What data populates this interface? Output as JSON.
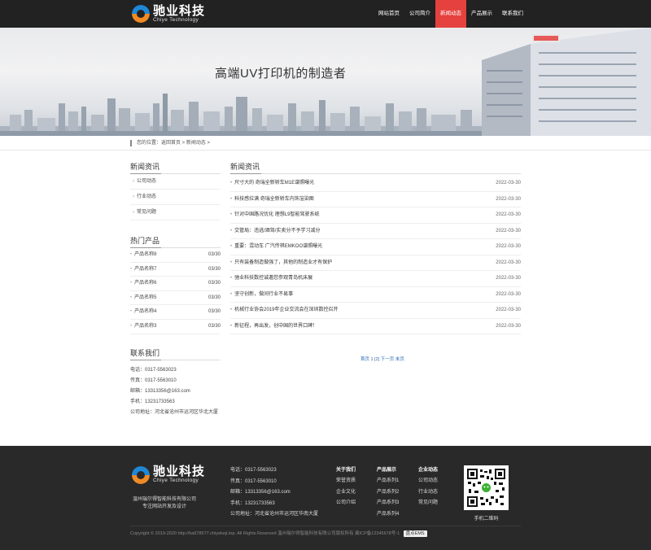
{
  "brand": {
    "name_cn": "驰业科技",
    "name_en": "Chiye Technology",
    "colors": {
      "accent": "#e5413e",
      "header_bg": "#222222",
      "footer_bg": "#292929",
      "logo_blue": "#1e88d6",
      "logo_orange": "#f08a24"
    }
  },
  "nav": {
    "items": [
      {
        "label": "网站首页"
      },
      {
        "label": "公司简介"
      },
      {
        "label": "新闻动态"
      },
      {
        "label": "产品展示"
      },
      {
        "label": "联系我们"
      }
    ],
    "active_index": 2
  },
  "banner": {
    "title": "高端UV打印机的制造者"
  },
  "breadcrumb": {
    "text": "您的位置：返回首页 > 新闻动态 >"
  },
  "sidebar": {
    "news_title": "新闻资讯",
    "categories": [
      {
        "label": "公司动态"
      },
      {
        "label": "行业动态"
      },
      {
        "label": "常见问题"
      }
    ],
    "products_title": "热门产品",
    "products": [
      {
        "name": "产品名称8",
        "date": "03/30"
      },
      {
        "name": "产品名称7",
        "date": "03/30"
      },
      {
        "name": "产品名称6",
        "date": "03/30"
      },
      {
        "name": "产品名称5",
        "date": "03/30"
      },
      {
        "name": "产品名称4",
        "date": "03/30"
      },
      {
        "name": "产品名称3",
        "date": "03/30"
      }
    ],
    "contact_title": "联系我们",
    "contact": [
      {
        "text": "电话：0317-5563023"
      },
      {
        "text": "传真：0317-5563010"
      },
      {
        "text": "邮箱：13313356@163.com"
      },
      {
        "text": "手机：13231733563"
      },
      {
        "text": "公司地址：河北省沧州市运河区华北大厦"
      }
    ]
  },
  "news": {
    "title": "新闻资讯",
    "items": [
      {
        "title": "尺寸大的 奇瑞全新轿车M1E谍照曝光",
        "date": "2022-03-30"
      },
      {
        "title": "科技感拉满 奇瑞全新轿车内饰渲染图",
        "date": "2022-03-30"
      },
      {
        "title": "针对中国路况优化 理想L9智能驾驶系统",
        "date": "2022-03-30"
      },
      {
        "title": "交管局：违逃/酒驾/实卖分不予学习减分",
        "date": "2022-03-30"
      },
      {
        "title": "重要：混动车 广汽传祺EMKOO谍照曝光",
        "date": "2022-03-30"
      },
      {
        "title": "只有装备制造做强了，其他的制造业才有保护",
        "date": "2022-03-30"
      },
      {
        "title": "驰业科技数控诚邀您参观青岛机床展",
        "date": "2022-03-30"
      },
      {
        "title": "坚守创新，做间行业不易事",
        "date": "2022-03-30"
      },
      {
        "title": "机械行业协会2019年企业交流会在深圳数控召开",
        "date": "2022-03-30"
      },
      {
        "title": "新征程，再出发，创中国的世界口碑！",
        "date": "2022-03-30"
      }
    ],
    "pager": {
      "first": "首页",
      "current": "1",
      "page2": "[2]",
      "next": "下一页",
      "last": "末页"
    }
  },
  "footer": {
    "company_line1": "温州瑞尔得智能科技有限公司",
    "company_line2": "专注网站开发及设计",
    "contact": [
      {
        "text": "电话：0317-5563023"
      },
      {
        "text": "传真：0317-5563010"
      },
      {
        "text": "邮箱：13313356@163.com"
      },
      {
        "text": "手机：13231733563"
      },
      {
        "text": "公司地址：河北省沧州市运河区华南大厦"
      }
    ],
    "col1": {
      "heading": "关于我们",
      "items": [
        "荣誉资质",
        "企业文化",
        "公司介绍"
      ]
    },
    "col2": {
      "heading": "产品展示",
      "items": [
        "产品系列1",
        "产品系列2",
        "产品系列3",
        "产品系列4"
      ]
    },
    "col3": {
      "heading": "企业动态",
      "items": [
        "公司动态",
        "行业动态",
        "常见问题"
      ]
    },
    "qr_label": "手机二维码",
    "copyright": "Copyright © 2019-2020 http://ha678577.chiyekeji.top. All Rights Reserved 温州瑞尔得智能科技有限公司版权所有 冀ICP备12345678号-1",
    "badge": "盘点EMS"
  }
}
